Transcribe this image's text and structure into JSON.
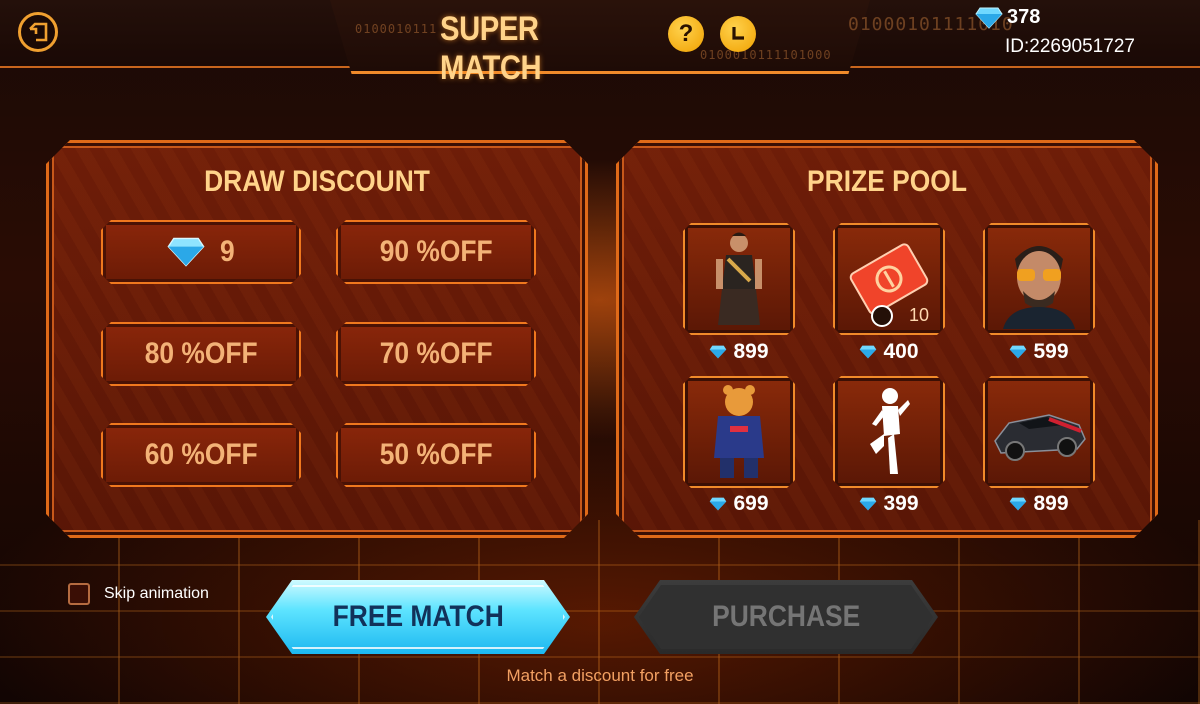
{
  "header": {
    "title": "SUPER MATCH",
    "help_icon": "question-icon",
    "history_icon": "clock-icon",
    "back_icon": "back-arrow-icon",
    "diamonds": "378",
    "player_id": "ID:2269051727"
  },
  "decor": {
    "binary_1": "0100010111101000",
    "binary_2": "0100010111",
    "binary_3": "0100010111101000",
    "binary_4": "01000101111010"
  },
  "draw_discount": {
    "title": "DRAW DISCOUNT",
    "options": [
      {
        "label": "9",
        "icon": "diamond-icon"
      },
      {
        "label": "90 %OFF"
      },
      {
        "label": "80 %OFF"
      },
      {
        "label": "70 %OFF"
      },
      {
        "label": "60 %OFF"
      },
      {
        "label": "50 %OFF"
      }
    ]
  },
  "prize_pool": {
    "title": "PRIZE POOL",
    "items": [
      {
        "name": "character-gladiator",
        "price": "899"
      },
      {
        "name": "ticket",
        "price": "400",
        "badge": "10",
        "badge_icon": "clock-icon"
      },
      {
        "name": "character-sunglasses",
        "price": "599"
      },
      {
        "name": "tiger-hoodie-bundle",
        "price": "699"
      },
      {
        "name": "emote",
        "price": "399"
      },
      {
        "name": "sports-car",
        "price": "899"
      }
    ]
  },
  "controls": {
    "skip_label": "Skip animation",
    "free_match": "FREE MATCH",
    "purchase": "PURCHASE",
    "hint": "Match a discount for free"
  },
  "colors": {
    "accent_orange": "#f08a2a",
    "free_match_cyan": "#5ee4ff",
    "title_gold": "#ffd38a"
  }
}
